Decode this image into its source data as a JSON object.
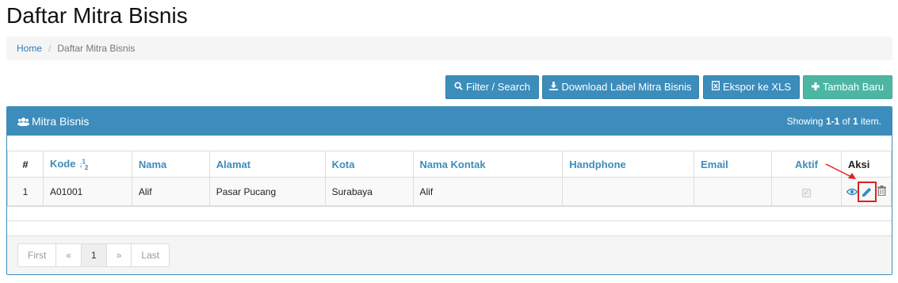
{
  "page": {
    "title": "Daftar Mitra Bisnis"
  },
  "breadcrumb": {
    "home": "Home",
    "separator": "/",
    "current": "Daftar Mitra Bisnis"
  },
  "toolbar": {
    "filter_label": "Filter / Search",
    "download_label": "Download Label Mitra Bisnis",
    "export_label": "Ekspor ke XLS",
    "add_label": "Tambah Baru"
  },
  "panel": {
    "title": "Mitra Bisnis",
    "summary_prefix": "Showing ",
    "summary_range": "1-1",
    "summary_of": " of ",
    "summary_total": "1",
    "summary_suffix": " item."
  },
  "table": {
    "headers": {
      "num": "#",
      "kode": "Kode",
      "nama": "Nama",
      "alamat": "Alamat",
      "kota": "Kota",
      "nama_kontak": "Nama Kontak",
      "handphone": "Handphone",
      "email": "Email",
      "aktif": "Aktif",
      "aksi": "Aksi"
    },
    "rows": [
      {
        "num": "1",
        "kode": "A01001",
        "nama": "Alif",
        "alamat": "Pasar Pucang",
        "kota": "Surabaya",
        "nama_kontak": "Alif",
        "handphone": "",
        "email": "",
        "aktif": true
      }
    ]
  },
  "pagination": {
    "first": "First",
    "prev": "«",
    "current": "1",
    "next": "»",
    "last": "Last"
  },
  "icons": {
    "filter": "search-icon",
    "download": "download-icon",
    "export": "file-excel-icon",
    "add": "plus-icon",
    "panel": "users-icon",
    "sort": "sort-numeric-icon",
    "view": "eye-icon",
    "edit": "pencil-icon",
    "delete": "trash-icon"
  },
  "colors": {
    "primary": "#3c8dbc",
    "success": "#4cb6a3",
    "highlight": "#e02020"
  }
}
